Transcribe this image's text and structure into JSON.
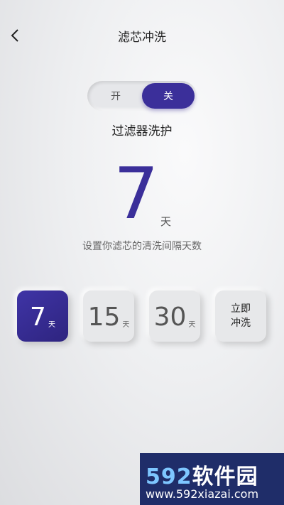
{
  "header": {
    "title": "滤芯冲洗",
    "back_icon": "chevron-left-icon"
  },
  "toggle": {
    "on_label": "开",
    "off_label": "关",
    "selected": "关",
    "accent": "#3b2f9a"
  },
  "section": {
    "title": "过滤器洗护"
  },
  "current": {
    "value": "7",
    "unit": "天"
  },
  "hint": "设置你滤芯的清洗间隔天数",
  "options": [
    {
      "value": "7",
      "unit": "天",
      "selected": true
    },
    {
      "value": "15",
      "unit": "天",
      "selected": false
    },
    {
      "value": "30",
      "unit": "天",
      "selected": false
    }
  ],
  "flush_button": {
    "line1": "立即",
    "line2": "冲洗"
  },
  "watermark": {
    "logo_num": "592",
    "logo_text": "软件园",
    "url": "www.592xiazai.com"
  }
}
